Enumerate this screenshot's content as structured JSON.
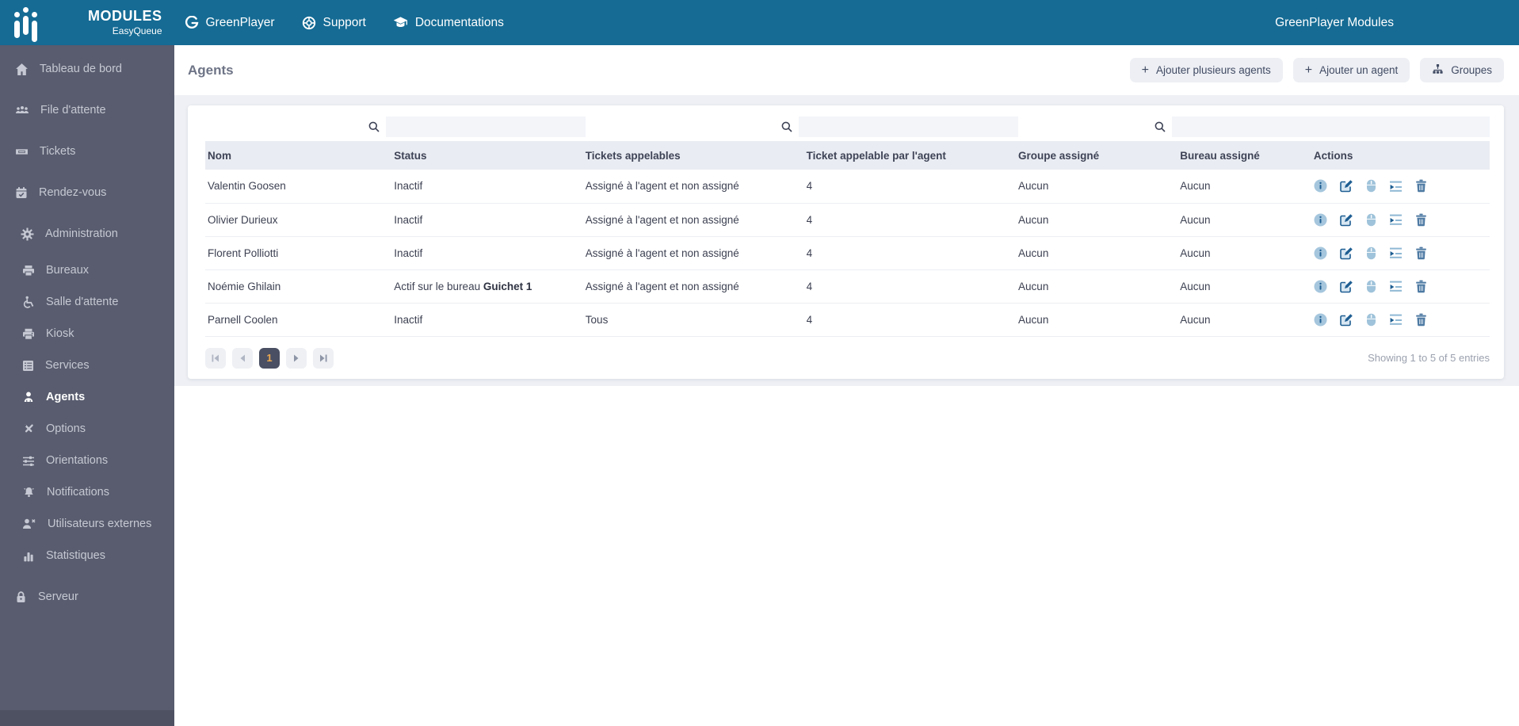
{
  "theme": {
    "navbar_bg": "#156b94",
    "sidebar_bg": "#585c6e",
    "band_bg": "#eef0f5",
    "table_header_bg": "#e9ecf2",
    "icon_blue_dark": "#1e5e92",
    "icon_blue_light": "#a5c6dd",
    "active_page_bg": "#4a4f63",
    "active_page_text": "#eda94f"
  },
  "navbar": {
    "brand": {
      "title": "MODULES",
      "subtitle": "EasyQueue"
    },
    "items": [
      {
        "label": "GreenPlayer",
        "icon": "greenplayer"
      },
      {
        "label": "Support",
        "icon": "life-ring"
      },
      {
        "label": "Documentations",
        "icon": "graduation-cap"
      }
    ],
    "right_title": "GreenPlayer Modules"
  },
  "sidebar": {
    "items": [
      {
        "label": "Tableau de bord",
        "icon": "home"
      },
      {
        "label": "File d'attente",
        "icon": "queue-users"
      },
      {
        "label": "Tickets",
        "icon": "ticket"
      },
      {
        "label": "Rendez-vous",
        "icon": "calendar-check"
      },
      {
        "label": "Administration",
        "icon": "gear"
      },
      {
        "label": "Bureaux",
        "icon": "printer"
      },
      {
        "label": "Salle d'attente",
        "icon": "wheelchair"
      },
      {
        "label": "Kiosk",
        "icon": "kiosk-printer"
      },
      {
        "label": "Services",
        "icon": "list"
      },
      {
        "label": "Agents",
        "icon": "person"
      },
      {
        "label": "Options",
        "icon": "tools"
      },
      {
        "label": "Orientations",
        "icon": "sliders"
      },
      {
        "label": "Notifications",
        "icon": "bell"
      },
      {
        "label": "Utilisateurs externes",
        "icon": "user-x"
      },
      {
        "label": "Statistiques",
        "icon": "bar-chart"
      },
      {
        "label": "Serveur",
        "icon": "lock"
      }
    ],
    "active_item": "Agents"
  },
  "page": {
    "title": "Agents",
    "buttons": [
      {
        "label": "Ajouter plusieurs agents",
        "icon": "plus"
      },
      {
        "label": "Ajouter un agent",
        "icon": "plus"
      },
      {
        "label": "Groupes",
        "icon": "sitemap"
      }
    ]
  },
  "search": {
    "placeholders": [
      "",
      "",
      ""
    ],
    "values": [
      "",
      "",
      ""
    ]
  },
  "table": {
    "columns": [
      "Nom",
      "Status",
      "Tickets appelables",
      "Ticket appelable par l'agent",
      "Groupe assigné",
      "Bureau assigné",
      "Actions"
    ],
    "action_icons": [
      "info",
      "edit",
      "mouse",
      "playlist",
      "trash"
    ],
    "rows": [
      {
        "nom": "Valentin Goosen",
        "status": "Inactif",
        "status_bold": "",
        "tickets": "Assigné à l'agent et non assigné",
        "appelable": "4",
        "groupe": "Aucun",
        "bureau": "Aucun"
      },
      {
        "nom": "Olivier Durieux",
        "status": "Inactif",
        "status_bold": "",
        "tickets": "Assigné à l'agent et non assigné",
        "appelable": "4",
        "groupe": "Aucun",
        "bureau": "Aucun"
      },
      {
        "nom": "Florent Polliotti",
        "status": "Inactif",
        "status_bold": "",
        "tickets": "Assigné à l'agent et non assigné",
        "appelable": "4",
        "groupe": "Aucun",
        "bureau": "Aucun"
      },
      {
        "nom": "Noémie Ghilain",
        "status": "Actif sur le bureau ",
        "status_bold": "Guichet 1",
        "tickets": "Assigné à l'agent et non assigné",
        "appelable": "4",
        "groupe": "Aucun",
        "bureau": "Aucun"
      },
      {
        "nom": "Parnell Coolen",
        "status": "Inactif",
        "status_bold": "",
        "tickets": "Tous",
        "appelable": "4",
        "groupe": "Aucun",
        "bureau": "Aucun"
      }
    ]
  },
  "pagination": {
    "current_page": "1",
    "footer": "Showing 1 to 5 of 5 entries"
  }
}
